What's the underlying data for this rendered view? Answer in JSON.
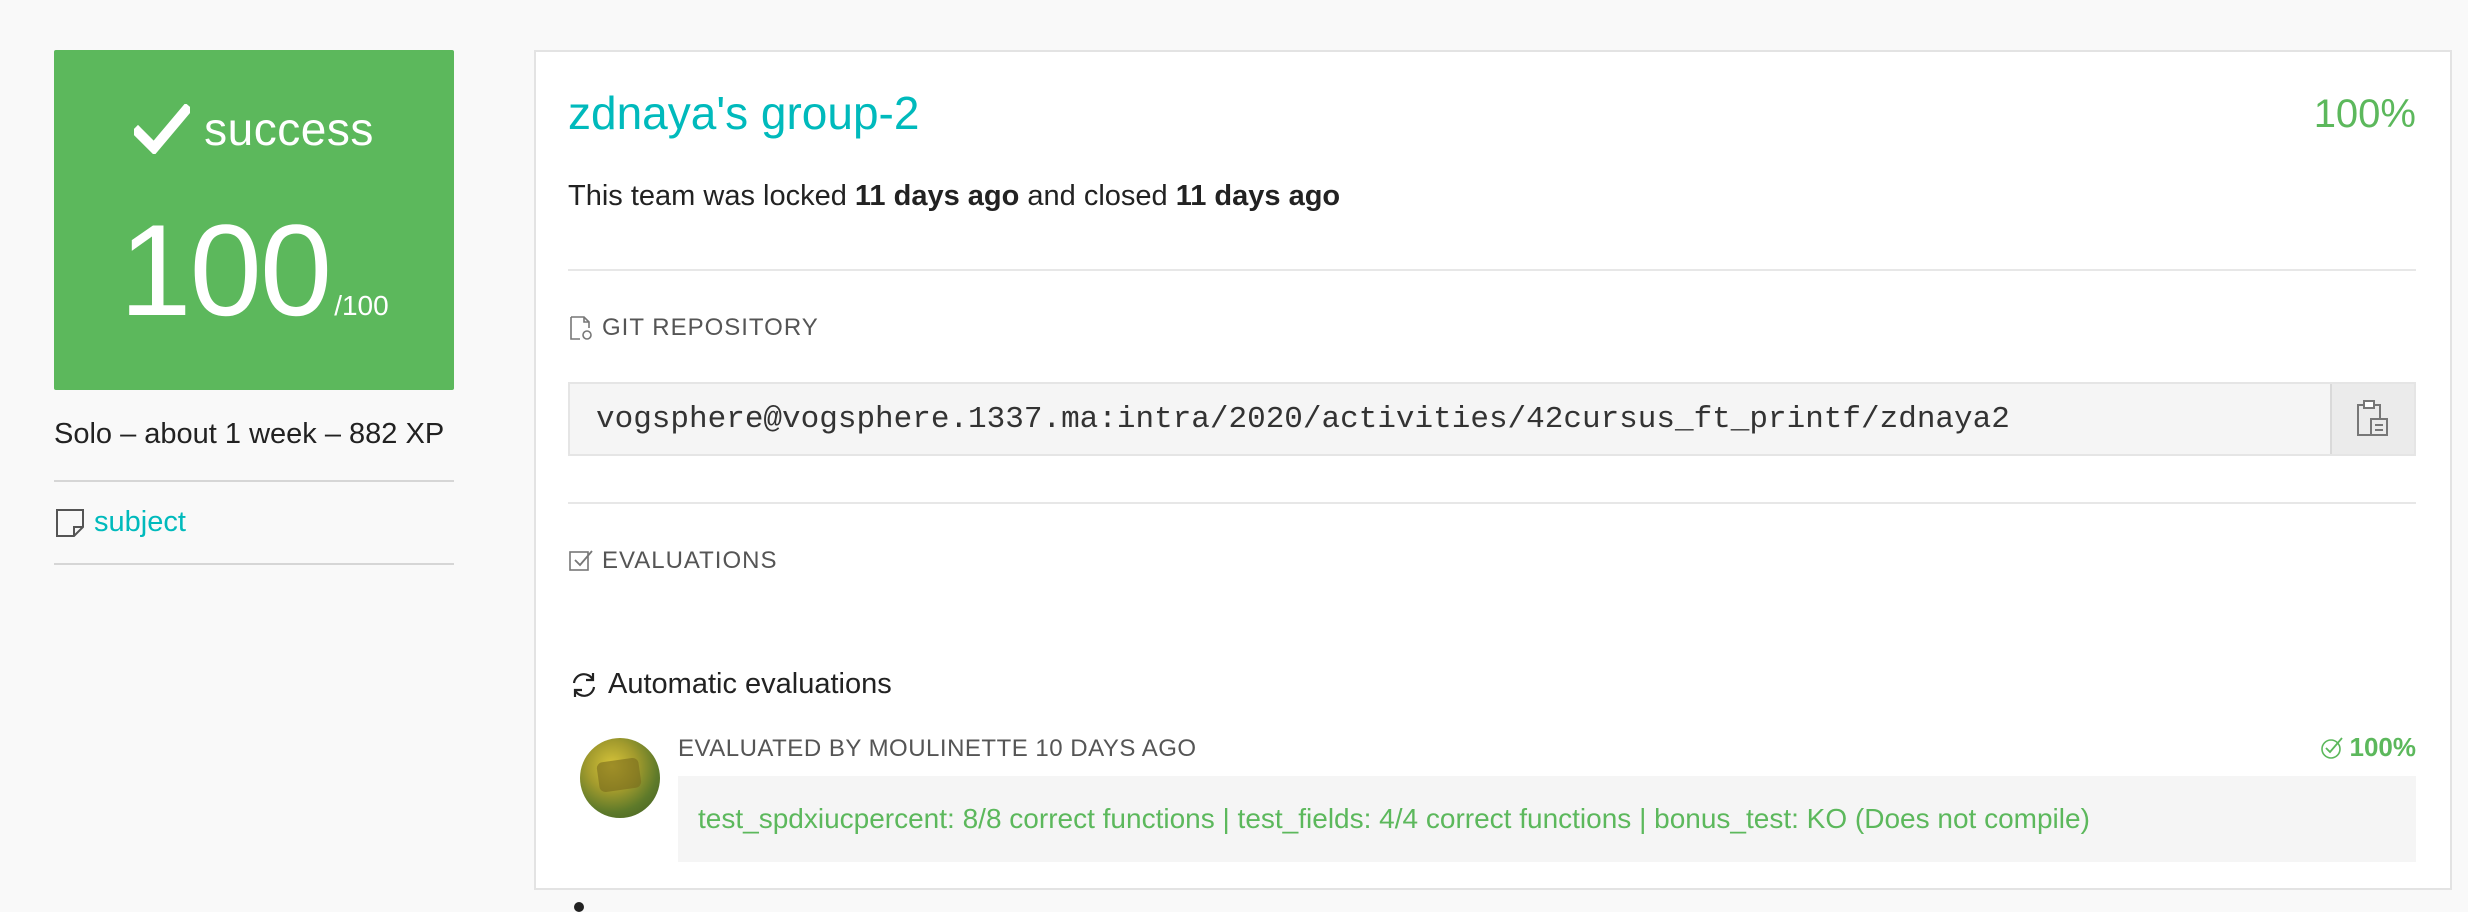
{
  "status": {
    "label": "success",
    "score": "100",
    "score_max": "/100",
    "color": "#5cb85c"
  },
  "project": {
    "meta": "Solo – about 1 week – 882 XP",
    "subject_label": "subject"
  },
  "team": {
    "title": "zdnaya's group-2",
    "percent": "100%",
    "info_prefix": "This team was locked ",
    "locked_time": "11 days ago",
    "info_middle": " and closed ",
    "closed_time": "11 days ago"
  },
  "git": {
    "heading": "GIT REPOSITORY",
    "repo_url": "vogsphere@vogsphere.1337.ma:intra/2020/activities/42cursus_ft_printf/zdnaya2"
  },
  "evaluations": {
    "heading": "EVALUATIONS",
    "auto_heading": "Automatic evaluations",
    "evaluated_by": "EVALUATED BY MOULINETTE 10 DAYS AGO",
    "score": "100%",
    "result": "test_spdxiucpercent: 8/8 correct functions | test_fields: 4/4 correct functions | bonus_test: KO (Does not compile)"
  },
  "colors": {
    "accent": "#00babc",
    "success": "#5cb85c"
  }
}
